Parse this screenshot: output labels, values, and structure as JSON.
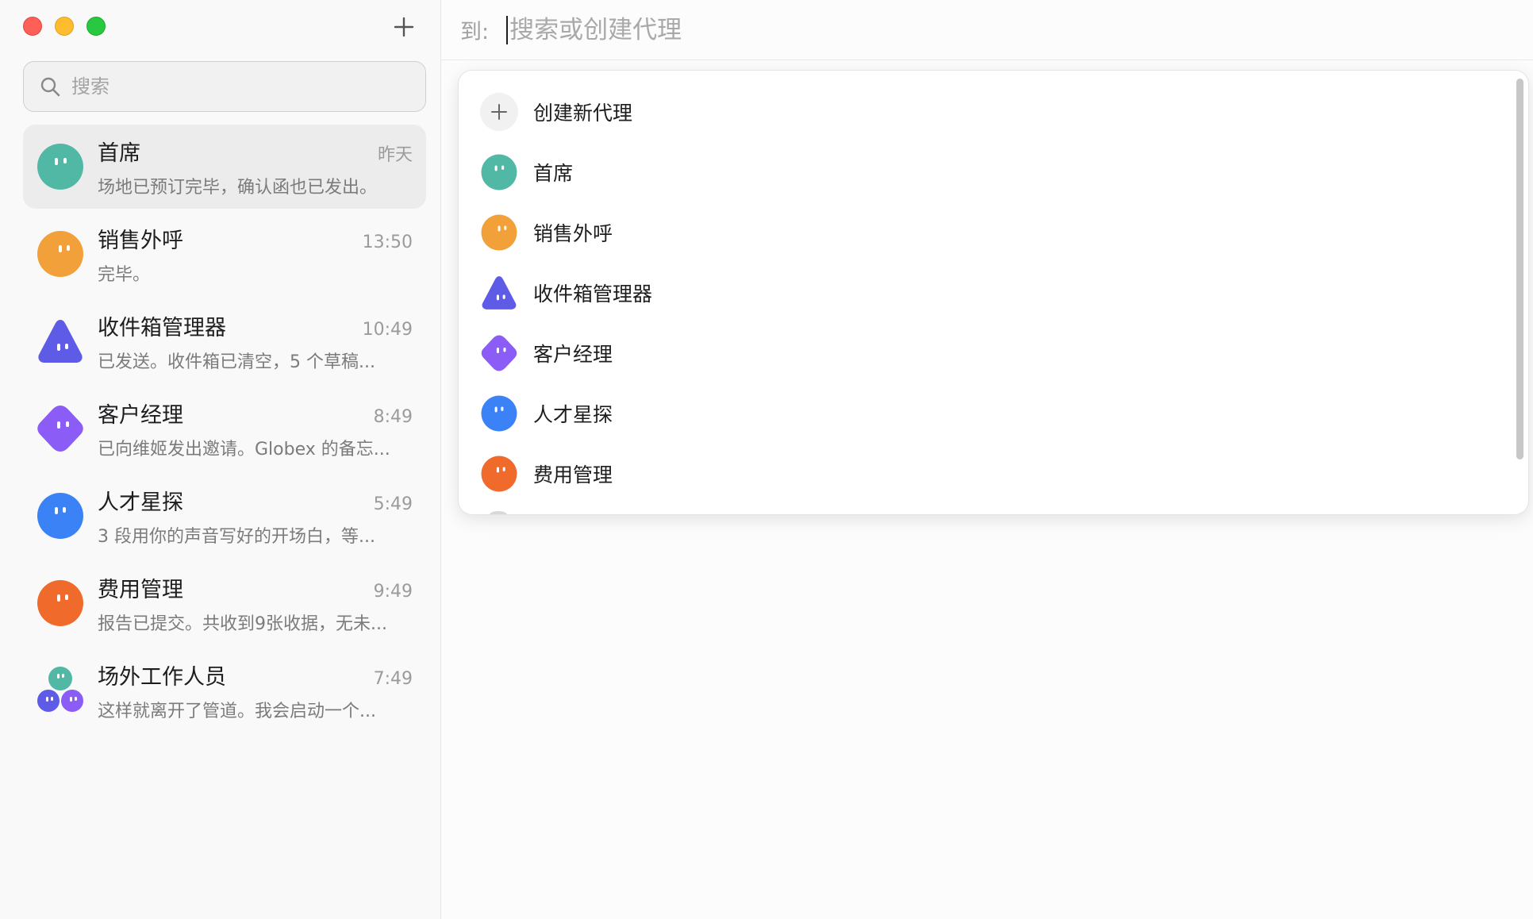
{
  "sidebar": {
    "search_placeholder": "搜索",
    "conversations": [
      {
        "name": "首席",
        "time": "昨天",
        "preview": "场地已预订完毕，确认函也已发出。",
        "avatar": "teal-circle-icon",
        "color": "#52b8a6"
      },
      {
        "name": "销售外呼",
        "time": "13:50",
        "preview": "完毕。",
        "avatar": "orange-circle-icon",
        "color": "#f2a03a"
      },
      {
        "name": "收件箱管理器",
        "time": "10:49",
        "preview": "已发送。收件箱已清空，5 个草稿...",
        "avatar": "indigo-triangle-icon",
        "color": "#5e5ce6"
      },
      {
        "name": "客户经理",
        "time": "8:49",
        "preview": "已向维姬发出邀请。Globex 的备忘...",
        "avatar": "purple-diamond-icon",
        "color": "#8b5cf6"
      },
      {
        "name": "人才星探",
        "time": "5:49",
        "preview": "3 段用你的声音写好的开场白，等...",
        "avatar": "blue-circle-icon",
        "color": "#3b82f6"
      },
      {
        "name": "费用管理",
        "time": "9:49",
        "preview": "报告已提交。共收到9张收据，无未...",
        "avatar": "red-orange-circle-icon",
        "color": "#f06a2c"
      },
      {
        "name": "场外工作人员",
        "time": "7:49",
        "preview": "这样就离开了管道。我会启动一个...",
        "avatar": "group-avatar-icon",
        "color": "#52b8a6"
      }
    ]
  },
  "main": {
    "to_label": "到:",
    "to_placeholder": "搜索或创建代理",
    "dropdown": {
      "create_label": "创建新代理",
      "agents": [
        {
          "name": "首席",
          "avatar": "teal-circle-icon",
          "color": "#52b8a6"
        },
        {
          "name": "销售外呼",
          "avatar": "orange-circle-icon",
          "color": "#f2a03a"
        },
        {
          "name": "收件箱管理器",
          "avatar": "indigo-triangle-icon",
          "color": "#5e5ce6"
        },
        {
          "name": "客户经理",
          "avatar": "purple-diamond-icon",
          "color": "#8b5cf6"
        },
        {
          "name": "人才星探",
          "avatar": "blue-circle-icon",
          "color": "#3b82f6"
        },
        {
          "name": "费用管理",
          "avatar": "red-orange-circle-icon",
          "color": "#f06a2c"
        }
      ]
    }
  }
}
